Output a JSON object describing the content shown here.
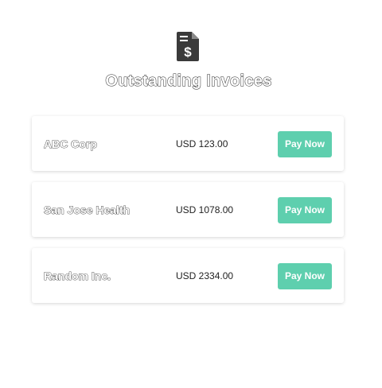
{
  "header": {
    "icon": "invoice-dollar-icon",
    "title": "Outstanding Invoices"
  },
  "colors": {
    "accent": "#5ecfae",
    "icon": "#3a3a3a"
  },
  "invoices": [
    {
      "company": "ABC Corp",
      "amount": "USD 123.00",
      "action": "Pay Now"
    },
    {
      "company": "San Jose Health",
      "amount": "USD 1078.00",
      "action": "Pay Now"
    },
    {
      "company": "Random Inc.",
      "amount": "USD 2334.00",
      "action": "Pay Now"
    }
  ]
}
